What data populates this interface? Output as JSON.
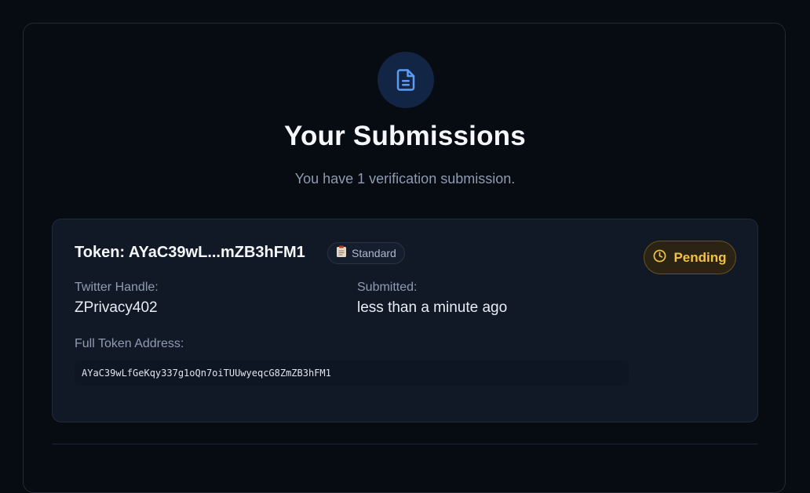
{
  "header": {
    "icon": "file-text-icon",
    "title": "Your Submissions",
    "subtitle": "You have 1 verification submission."
  },
  "submission": {
    "token_title": "Token: AYaC39wL...mZB3hFM1",
    "type_badge": {
      "icon": "clipboard-icon",
      "label": "Standard"
    },
    "status": {
      "icon": "clock-icon",
      "label": "Pending",
      "color": "#f2c14a"
    },
    "twitter_label": "Twitter Handle:",
    "twitter_value": "ZPrivacy402",
    "submitted_label": "Submitted:",
    "submitted_value": "less than a minute ago",
    "address_label": "Full Token Address:",
    "address_value": "AYaC39wLfGeKqy337g1oQn7oiTUUwyeqcG8ZmZB3hFM1"
  },
  "colors": {
    "background": "#070b12",
    "card": "#111927",
    "accent": "#4f8fe8",
    "pending": "#f2c14a"
  }
}
